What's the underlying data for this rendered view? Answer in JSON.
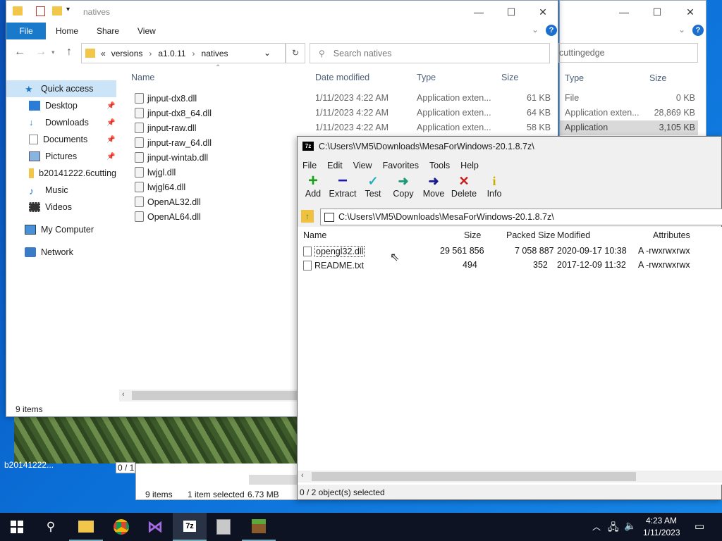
{
  "colors": {
    "accent": "#1979ca",
    "folder": "#f2c64b",
    "taskbar": "#0d1322"
  },
  "back_explorer": {
    "search_value": "cuttingedge",
    "columns": [
      "Type",
      "Size"
    ],
    "rows": [
      {
        "type": "File",
        "size": "0 KB"
      },
      {
        "type": "Application exten...",
        "size": "28,869 KB"
      },
      {
        "type": "Application",
        "size": "3,105 KB"
      }
    ]
  },
  "explorer": {
    "title": "natives",
    "ribbon_tabs": [
      "File",
      "Home",
      "Share",
      "View"
    ],
    "breadcrumb": [
      "«",
      "versions",
      "a1.0.11",
      "natives"
    ],
    "search_placeholder": "Search natives",
    "sidebar": [
      {
        "label": "Quick access",
        "icon": "star-icon"
      },
      {
        "label": "Desktop",
        "icon": "desktop-icon"
      },
      {
        "label": "Downloads",
        "icon": "download-icon"
      },
      {
        "label": "Documents",
        "icon": "documents-icon"
      },
      {
        "label": "Pictures",
        "icon": "pictures-icon"
      },
      {
        "label": "b20141222.6cutting",
        "icon": "folder-icon"
      },
      {
        "label": "Music",
        "icon": "music-icon"
      },
      {
        "label": "Videos",
        "icon": "videos-icon"
      },
      {
        "label": "My Computer",
        "icon": "computer-icon"
      },
      {
        "label": "Network",
        "icon": "network-icon"
      }
    ],
    "columns": [
      "Name",
      "Date modified",
      "Type",
      "Size"
    ],
    "files": [
      {
        "name": "jinput-dx8.dll",
        "date": "1/11/2023 4:22 AM",
        "type": "Application exten...",
        "size": "61 KB"
      },
      {
        "name": "jinput-dx8_64.dll",
        "date": "1/11/2023 4:22 AM",
        "type": "Application exten...",
        "size": "64 KB"
      },
      {
        "name": "jinput-raw.dll",
        "date": "1/11/2023 4:22 AM",
        "type": "Application exten...",
        "size": "58 KB"
      },
      {
        "name": "jinput-raw_64.dll"
      },
      {
        "name": "jinput-wintab.dll"
      },
      {
        "name": "lwjgl.dll"
      },
      {
        "name": "lwjgl64.dll"
      },
      {
        "name": "OpenAL32.dll"
      },
      {
        "name": "OpenAL64.dll"
      }
    ],
    "status": "9 items"
  },
  "bg_window": {
    "status_items": "9 items",
    "status_selected": "1 item selected",
    "status_size": "6.73 MB",
    "desktop_label": "b20141222...",
    "page_indicator": "0 / 1"
  },
  "sevenzip": {
    "title": "C:\\Users\\VM5\\Downloads\\MesaForWindows-20.1.8.7z\\",
    "menu": [
      "File",
      "Edit",
      "View",
      "Favorites",
      "Tools",
      "Help"
    ],
    "toolbar": [
      {
        "label": "Add",
        "icon": "add-icon",
        "glyph": "+",
        "color": "#1aa01a"
      },
      {
        "label": "Extract",
        "icon": "extract-icon",
        "glyph": "−",
        "color": "#1a1ab0"
      },
      {
        "label": "Test",
        "icon": "test-icon",
        "glyph": "✓",
        "color": "#20b0c0"
      },
      {
        "label": "Copy",
        "icon": "copy-icon",
        "glyph": "➜",
        "color": "#1a9a7a"
      },
      {
        "label": "Move",
        "icon": "move-icon",
        "glyph": "➜",
        "color": "#1a1a90"
      },
      {
        "label": "Delete",
        "icon": "delete-icon",
        "glyph": "✕",
        "color": "#d01a1a"
      },
      {
        "label": "Info",
        "icon": "info-icon",
        "glyph": "i",
        "color": "#c8b000"
      }
    ],
    "address": "C:\\Users\\VM5\\Downloads\\MesaForWindows-20.1.8.7z\\",
    "columns": [
      "Name",
      "Size",
      "Packed Size",
      "Modified",
      "Attributes"
    ],
    "files": [
      {
        "name": "opengl32.dll",
        "size": "29 561 856",
        "packed": "7 058 887",
        "modified": "2020-09-17 10:38",
        "attr": "A -rwxrwxrwx"
      },
      {
        "name": "README.txt",
        "size": "494",
        "packed": "352",
        "modified": "2017-12-09 11:32",
        "attr": "A -rwxrwxrwx"
      }
    ],
    "status": "0 / 2 object(s) selected"
  },
  "taskbar": {
    "time": "4:23 AM",
    "date": "1/11/2023"
  }
}
